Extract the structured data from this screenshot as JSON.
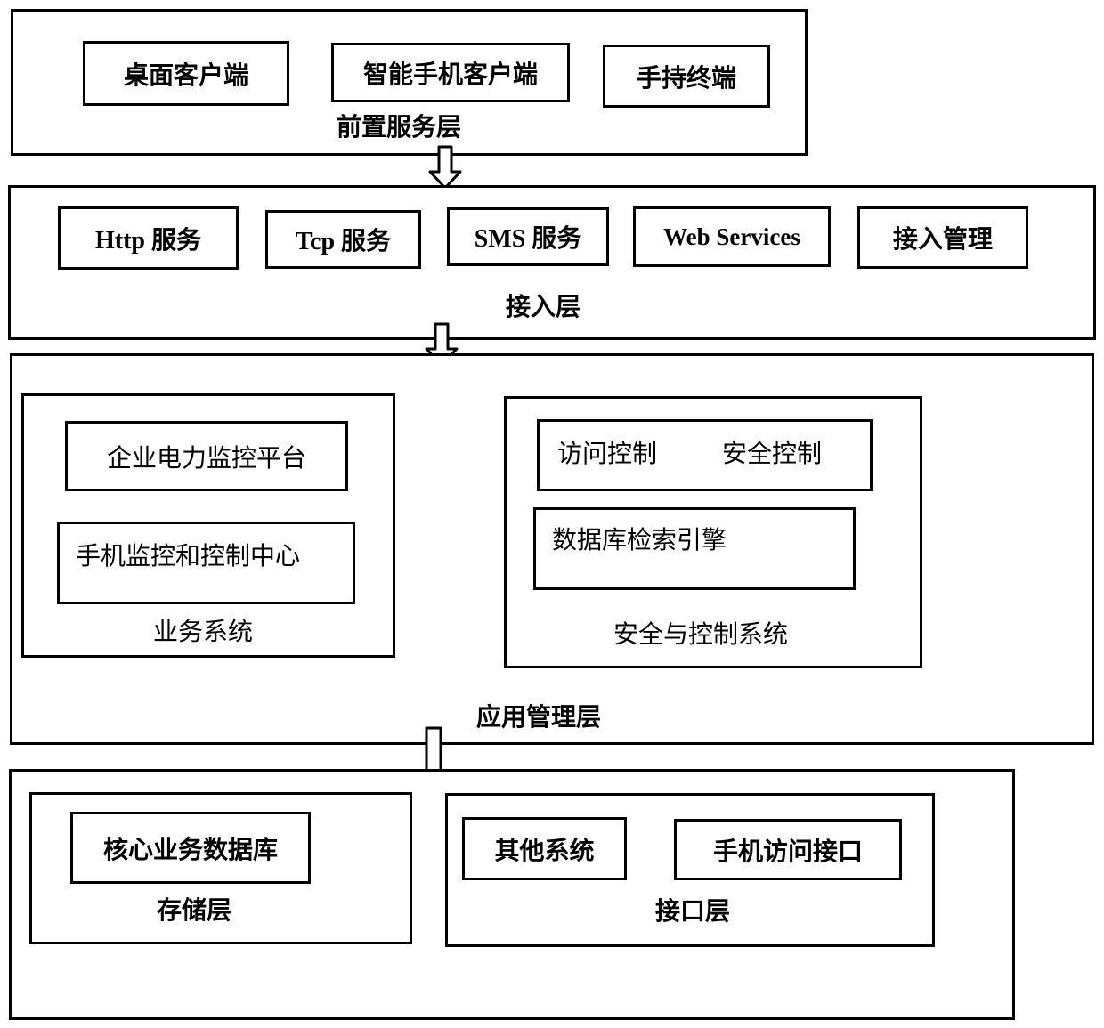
{
  "front_layer": {
    "title": "前置服务层",
    "items": [
      "桌面客户端",
      "智能手机客户端",
      "手持终端"
    ]
  },
  "access_layer": {
    "title": "接入层",
    "items": [
      "Http 服务",
      "Tcp 服务",
      "SMS 服务",
      "Web Services",
      "接入管理"
    ]
  },
  "app_layer": {
    "title": "应用管理层",
    "business_system": {
      "title": "业务系统",
      "items": [
        "企业电力监控平台",
        "手机监控和控制中心"
      ]
    },
    "security_system": {
      "title": "安全与控制系统",
      "access_control": "访问控制",
      "security_control": "安全控制",
      "db_engine": "数据库检索引擎"
    }
  },
  "bottom_layer": {
    "storage": {
      "title": "存储层",
      "items": [
        "核心业务数据库"
      ]
    },
    "interface": {
      "title": "接口层",
      "items": [
        "其他系统",
        "手机访问接口"
      ]
    }
  }
}
